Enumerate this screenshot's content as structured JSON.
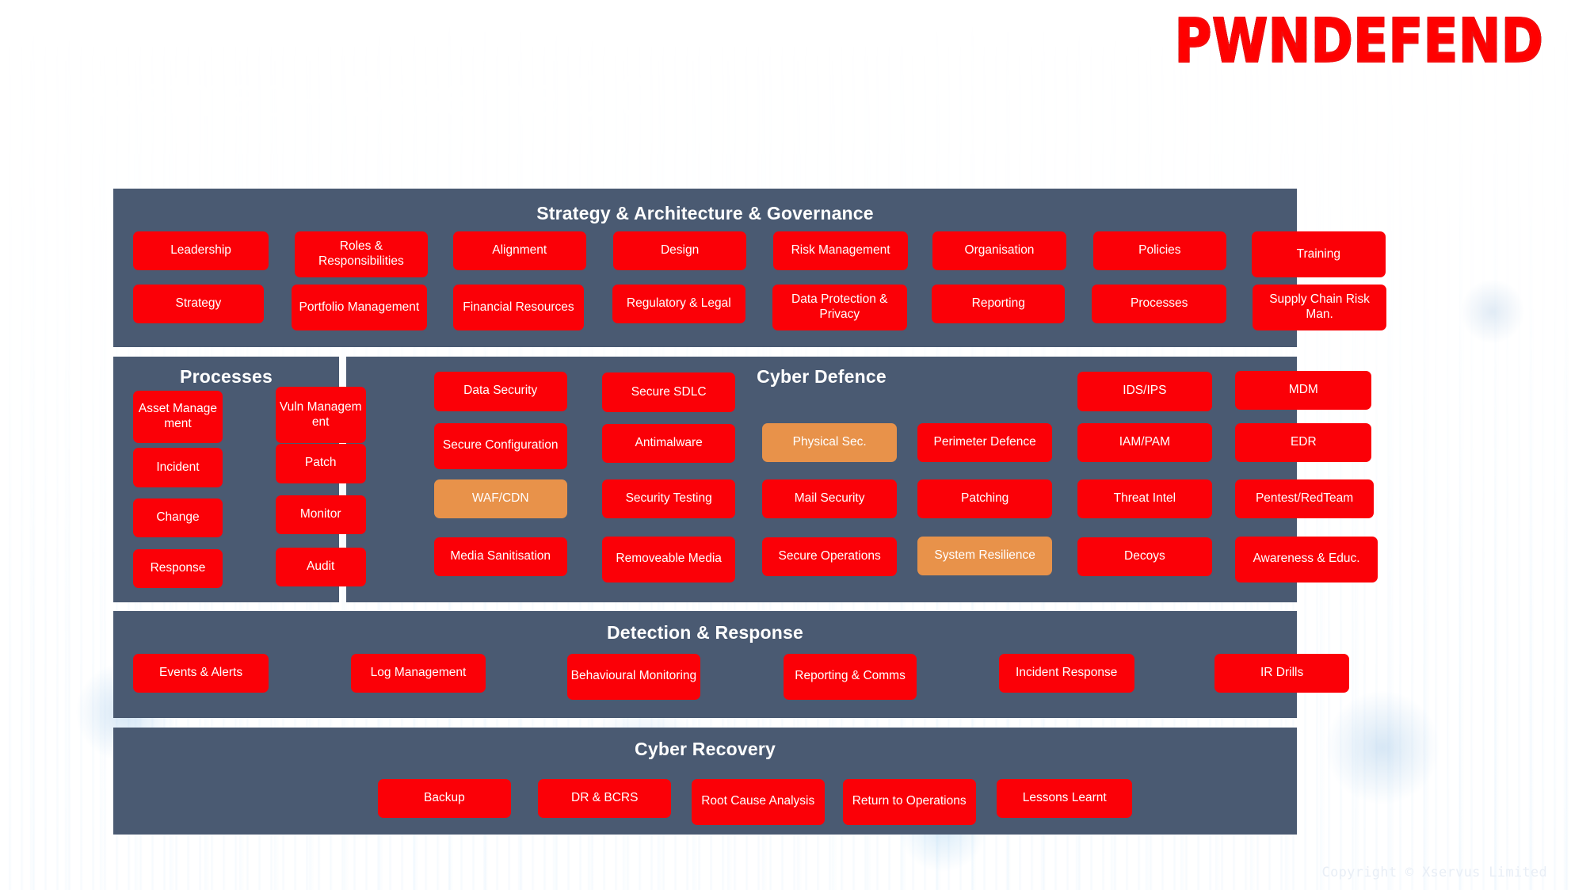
{
  "slide": {
    "title": "Heatmap – Baseline 0.0",
    "logo": "PWNDEFEND",
    "footer": "Copyright © Xservus Limited"
  },
  "colors": {
    "red": "#fb0007",
    "amber": "#e8924a",
    "panel": "#4a5a72",
    "background": "#071021",
    "logo_red": "#f50b0b"
  },
  "legend": {
    "red_meaning": "red",
    "amber_meaning": "amber"
  },
  "sections": [
    {
      "id": "strategy",
      "title": "Strategy & Architecture & Governance",
      "tiles": [
        {
          "label": "Leadership",
          "status": "red"
        },
        {
          "label": "Roles & Responsibilities",
          "status": "red"
        },
        {
          "label": "Alignment",
          "status": "red"
        },
        {
          "label": "Design",
          "status": "red"
        },
        {
          "label": "Risk Management",
          "status": "red"
        },
        {
          "label": "Organisation",
          "status": "red"
        },
        {
          "label": "Policies",
          "status": "red"
        },
        {
          "label": "Training",
          "status": "red"
        },
        {
          "label": "Strategy",
          "status": "red"
        },
        {
          "label": "Portfolio Management",
          "status": "red"
        },
        {
          "label": "Financial Resources",
          "status": "red"
        },
        {
          "label": "Regulatory & Legal",
          "status": "red"
        },
        {
          "label": "Data Protection & Privacy",
          "status": "red"
        },
        {
          "label": "Reporting",
          "status": "red"
        },
        {
          "label": "Processes",
          "status": "red"
        },
        {
          "label": "Supply Chain Risk Man.",
          "status": "red"
        }
      ]
    },
    {
      "id": "processes",
      "title": "Processes",
      "tiles": [
        {
          "label": "Asset Management",
          "status": "red"
        },
        {
          "label": "Vuln Management",
          "status": "red"
        },
        {
          "label": "Incident",
          "status": "red"
        },
        {
          "label": "Patch",
          "status": "red"
        },
        {
          "label": "Change",
          "status": "red"
        },
        {
          "label": "Monitor",
          "status": "red"
        },
        {
          "label": "Response",
          "status": "red"
        },
        {
          "label": "Audit",
          "status": "red"
        }
      ]
    },
    {
      "id": "cyber-defence",
      "title": "Cyber Defence",
      "tiles": [
        {
          "label": "Data Security",
          "status": "red"
        },
        {
          "label": "Secure SDLC",
          "status": "red"
        },
        {
          "label": "IDS/IPS",
          "status": "red"
        },
        {
          "label": "MDM",
          "status": "red"
        },
        {
          "label": "Secure Configuration",
          "status": "red"
        },
        {
          "label": "Antimalware",
          "status": "red"
        },
        {
          "label": "Physical Sec.",
          "status": "amber"
        },
        {
          "label": "Perimeter Defence",
          "status": "red"
        },
        {
          "label": "IAM/PAM",
          "status": "red"
        },
        {
          "label": "EDR",
          "status": "red"
        },
        {
          "label": "WAF/CDN",
          "status": "amber"
        },
        {
          "label": "Security Testing",
          "status": "red"
        },
        {
          "label": "Mail Security",
          "status": "red"
        },
        {
          "label": "Patching",
          "status": "red"
        },
        {
          "label": "Threat Intel",
          "status": "red"
        },
        {
          "label": "Pentest/RedTeam",
          "status": "red",
          "misspelled_part": "RedTeam"
        },
        {
          "label": "Media Sanitisation",
          "status": "red"
        },
        {
          "label": "Removeable Media",
          "status": "red"
        },
        {
          "label": "Secure Operations",
          "status": "red"
        },
        {
          "label": "System Resilience",
          "status": "amber"
        },
        {
          "label": "Decoys",
          "status": "red"
        },
        {
          "label": "Awareness & Educ.",
          "status": "red"
        }
      ]
    },
    {
      "id": "detection-response",
      "title": "Detection & Response",
      "tiles": [
        {
          "label": "Events & Alerts",
          "status": "red"
        },
        {
          "label": "Log Management",
          "status": "red"
        },
        {
          "label": "Behavioural Monitoring",
          "status": "red"
        },
        {
          "label": "Reporting & Comms",
          "status": "red"
        },
        {
          "label": "Incident Response",
          "status": "red"
        },
        {
          "label": "IR Drills",
          "status": "red"
        }
      ]
    },
    {
      "id": "cyber-recovery",
      "title": "Cyber Recovery",
      "tiles": [
        {
          "label": "Backup",
          "status": "red"
        },
        {
          "label": "DR & BCRS",
          "status": "red"
        },
        {
          "label": "Root Cause Analysis",
          "status": "red"
        },
        {
          "label": "Return to Operations",
          "status": "red"
        },
        {
          "label": "Lessons Learnt",
          "status": "red"
        }
      ]
    }
  ]
}
